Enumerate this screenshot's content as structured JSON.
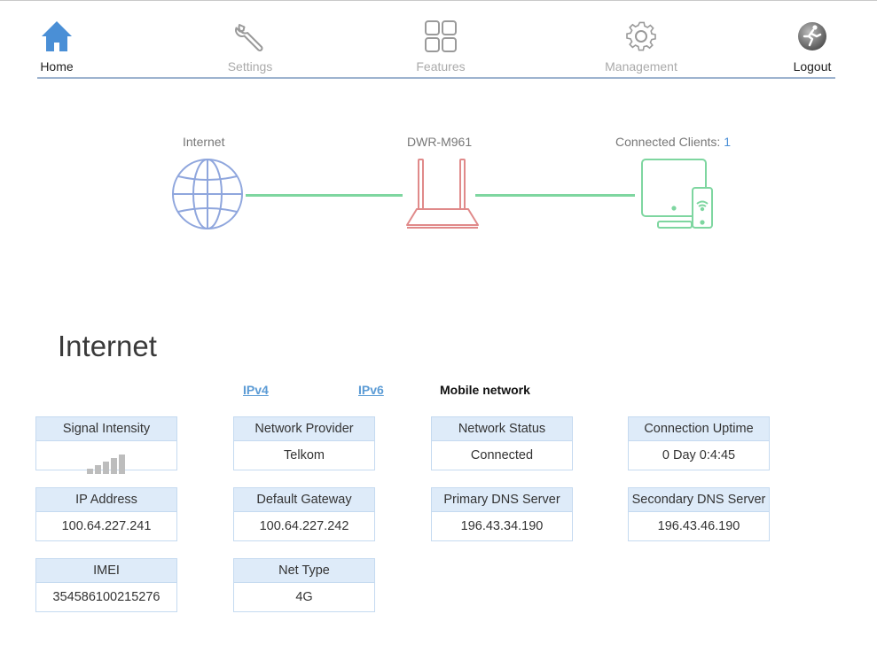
{
  "nav": {
    "items": [
      {
        "label": "Home",
        "icon": "home-icon"
      },
      {
        "label": "Settings",
        "icon": "wrench-icon"
      },
      {
        "label": "Features",
        "icon": "grid-icon"
      },
      {
        "label": "Management",
        "icon": "gear-icon"
      },
      {
        "label": "Logout",
        "icon": "logout-icon"
      }
    ]
  },
  "diagram": {
    "internet_label": "Internet",
    "router_label": "DWR-M961",
    "clients_label": "Connected Clients: ",
    "clients_count": "1"
  },
  "section": {
    "title": "Internet",
    "tabs": {
      "ipv4": "IPv4",
      "ipv6": "IPv6",
      "mobile": "Mobile network"
    }
  },
  "cards": {
    "signal": {
      "label": "Signal Intensity",
      "level": 4,
      "max": 5
    },
    "provider": {
      "label": "Network Provider",
      "value": "Telkom"
    },
    "status": {
      "label": "Network Status",
      "value": "Connected"
    },
    "uptime": {
      "label": "Connection Uptime",
      "value": "0 Day 0:4:45"
    },
    "ip": {
      "label": "IP Address",
      "value": "100.64.227.241"
    },
    "gateway": {
      "label": "Default Gateway",
      "value": "100.64.227.242"
    },
    "dns1": {
      "label": "Primary DNS Server",
      "value": "196.43.34.190"
    },
    "dns2": {
      "label": "Secondary DNS Server",
      "value": "196.43.46.190"
    },
    "imei": {
      "label": "IMEI",
      "value": "354586100215276"
    },
    "nettype": {
      "label": "Net Type",
      "value": "4G"
    }
  },
  "colors": {
    "accent": "#4a8fd6",
    "link_green": "#7ed6a0",
    "router": "#e08a8a",
    "globe": "#8fa6dd"
  }
}
